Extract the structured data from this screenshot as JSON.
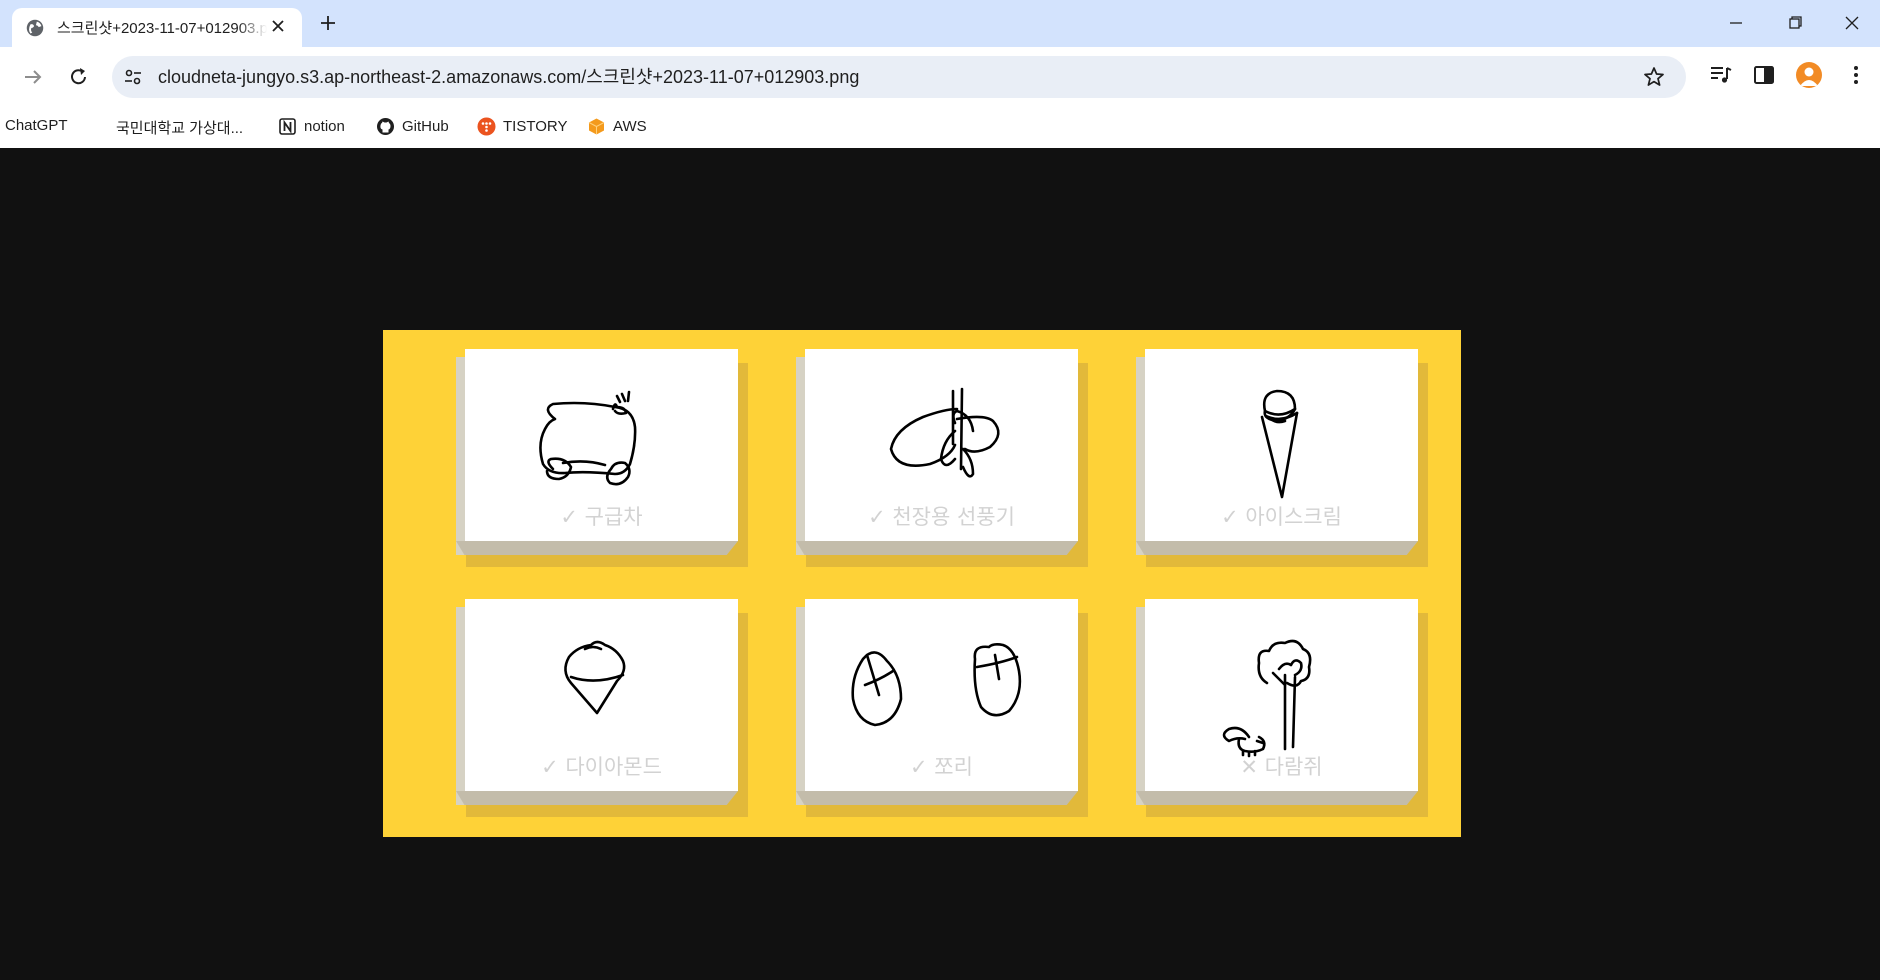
{
  "browser": {
    "tab": {
      "title": "스크린샷+2023-11-07+012903.png"
    },
    "address_bar": {
      "url": "cloudneta-jungyo.s3.ap-northeast-2.amazonaws.com/스크린샷+2023-11-07+012903.png"
    },
    "bookmarks": [
      {
        "label": "ChatGPT",
        "icon": "chatgpt-icon"
      },
      {
        "label": "국민대학교 가상대...",
        "icon": "kookmin-icon"
      },
      {
        "label": "notion",
        "icon": "notion-icon"
      },
      {
        "label": "GitHub",
        "icon": "github-icon"
      },
      {
        "label": "TISTORY",
        "icon": "tistory-icon"
      },
      {
        "label": "AWS",
        "icon": "aws-icon"
      }
    ]
  },
  "image": {
    "cards": [
      {
        "label": "✓ 구급차",
        "drawing": "ambulance-doodle"
      },
      {
        "label": "✓ 천장용 선풍기",
        "drawing": "ceiling-fan-doodle"
      },
      {
        "label": "✓ 아이스크림",
        "drawing": "ice-cream-doodle"
      },
      {
        "label": "✓ 다이아몬드",
        "drawing": "diamond-doodle"
      },
      {
        "label": "✓ 쪼리",
        "drawing": "flip-flops-doodle"
      },
      {
        "label": "✕ 다람쥐",
        "drawing": "squirrel-doodle"
      }
    ]
  },
  "colors": {
    "board": "#fed237",
    "page_background": "#111111",
    "tabstrip": "#d3e3fd",
    "label": "#d2d2d2"
  }
}
